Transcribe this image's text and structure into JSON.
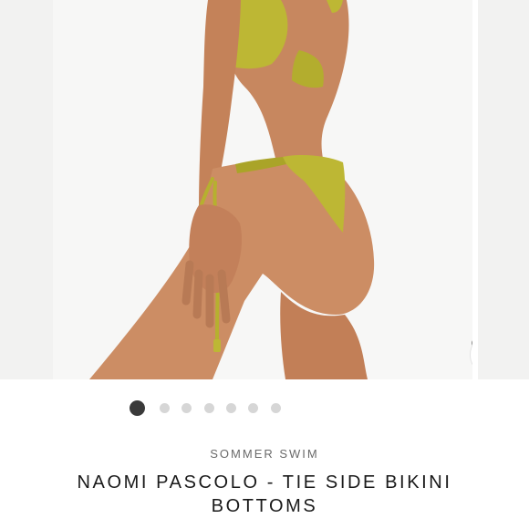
{
  "gallery": {
    "slide_count": 7,
    "active_index": 0,
    "zoom_icon": "magnifier-icon"
  },
  "product": {
    "brand": "SOMMER SWIM",
    "title": "NAOMI PASCOLO - TIE SIDE BIKINI BOTTOMS"
  },
  "colors": {
    "swimsuit": "#bdb734",
    "skin": "#c98a62",
    "background": "#f7f7f6",
    "dot_active": "#3a3a3a",
    "dot_inactive": "#d6d6d6"
  }
}
